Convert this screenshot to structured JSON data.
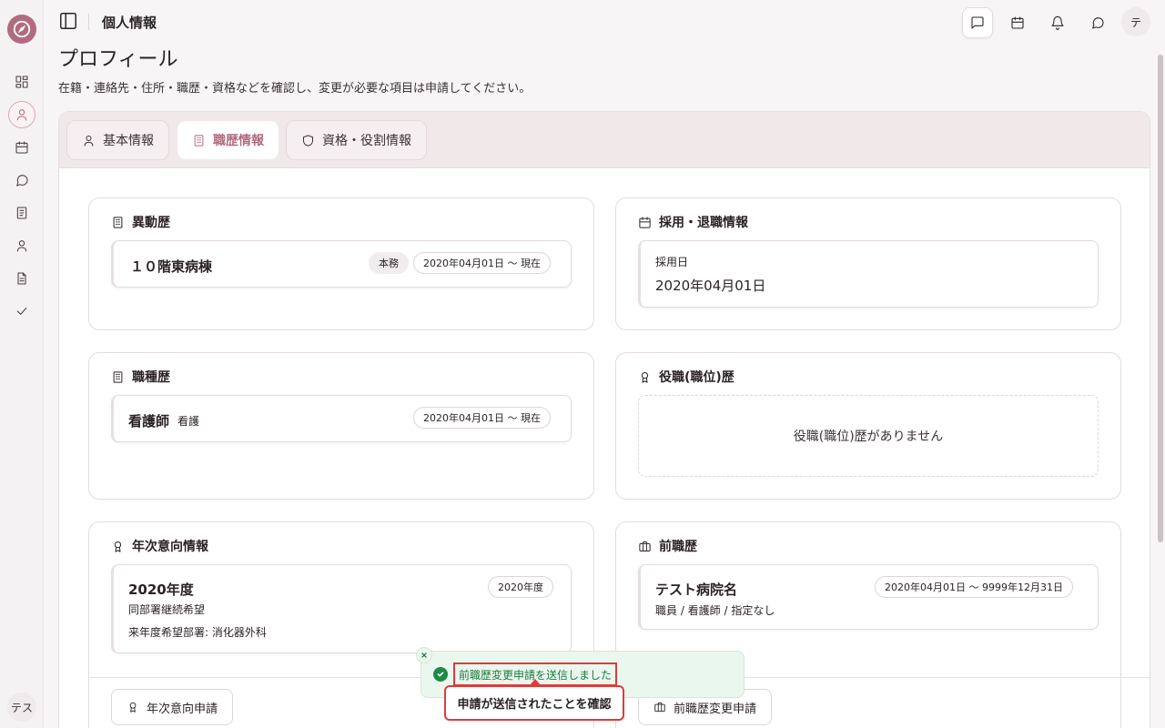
{
  "app": {
    "brand_color": "#b26b7e"
  },
  "sidebar": {
    "items": [
      {
        "icon": "dashboard-icon"
      },
      {
        "icon": "user-icon",
        "active": true
      },
      {
        "icon": "calendar-icon"
      },
      {
        "icon": "chat-icon"
      },
      {
        "icon": "book-icon"
      },
      {
        "icon": "person-icon"
      },
      {
        "icon": "document-icon"
      },
      {
        "icon": "check-icon"
      }
    ],
    "user_initial": "テス"
  },
  "header": {
    "title": "個人情報",
    "avatar_initial": "テ",
    "icons": [
      "message-square-icon",
      "calendar-icon",
      "bell-icon",
      "chat-icon"
    ]
  },
  "page": {
    "title": "プロフィール",
    "description": "在籍・連絡先・住所・職歴・資格などを確認し、変更が必要な項目は申請してください。"
  },
  "tabs": [
    {
      "label": "基本情報",
      "icon": "user-icon",
      "active": false
    },
    {
      "label": "職歴情報",
      "icon": "building-icon",
      "active": true
    },
    {
      "label": "資格・役割情報",
      "icon": "shield-icon",
      "active": false
    }
  ],
  "transfer_history": {
    "title": "異動歴",
    "entries": [
      {
        "name": "１０階東病棟",
        "tag": "本務",
        "period": "2020年04月01日 〜 現在"
      }
    ]
  },
  "employment": {
    "title": "採用・退職情報",
    "hire_label": "採用日",
    "hire_date": "2020年04月01日"
  },
  "job_type_history": {
    "title": "職種歴",
    "entries": [
      {
        "name": "看護師",
        "category": "看護",
        "period": "2020年04月01日 〜 現在"
      }
    ]
  },
  "position_history": {
    "title": "役職(職位)歴",
    "empty_text": "役職(職位)歴がありません"
  },
  "annual_intention": {
    "title": "年次意向情報",
    "year": "2020年度",
    "year_badge": "2020年度",
    "wish": "同部署継続希望",
    "next_dept": "来年度希望部署: 消化器外科"
  },
  "previous_jobs": {
    "title": "前職歴",
    "entries": [
      {
        "name": "テスト病院名",
        "period": "2020年04月01日 〜 9999年12月31日",
        "detail": "職員 / 看護師 / 指定なし"
      }
    ]
  },
  "actions": {
    "annual_request": "年次意向申請",
    "previous_job_request": "前職歴変更申請"
  },
  "toast": {
    "message": "前職歴変更申請を送信しました",
    "confirm_label": "申請が送信されたことを確認"
  }
}
